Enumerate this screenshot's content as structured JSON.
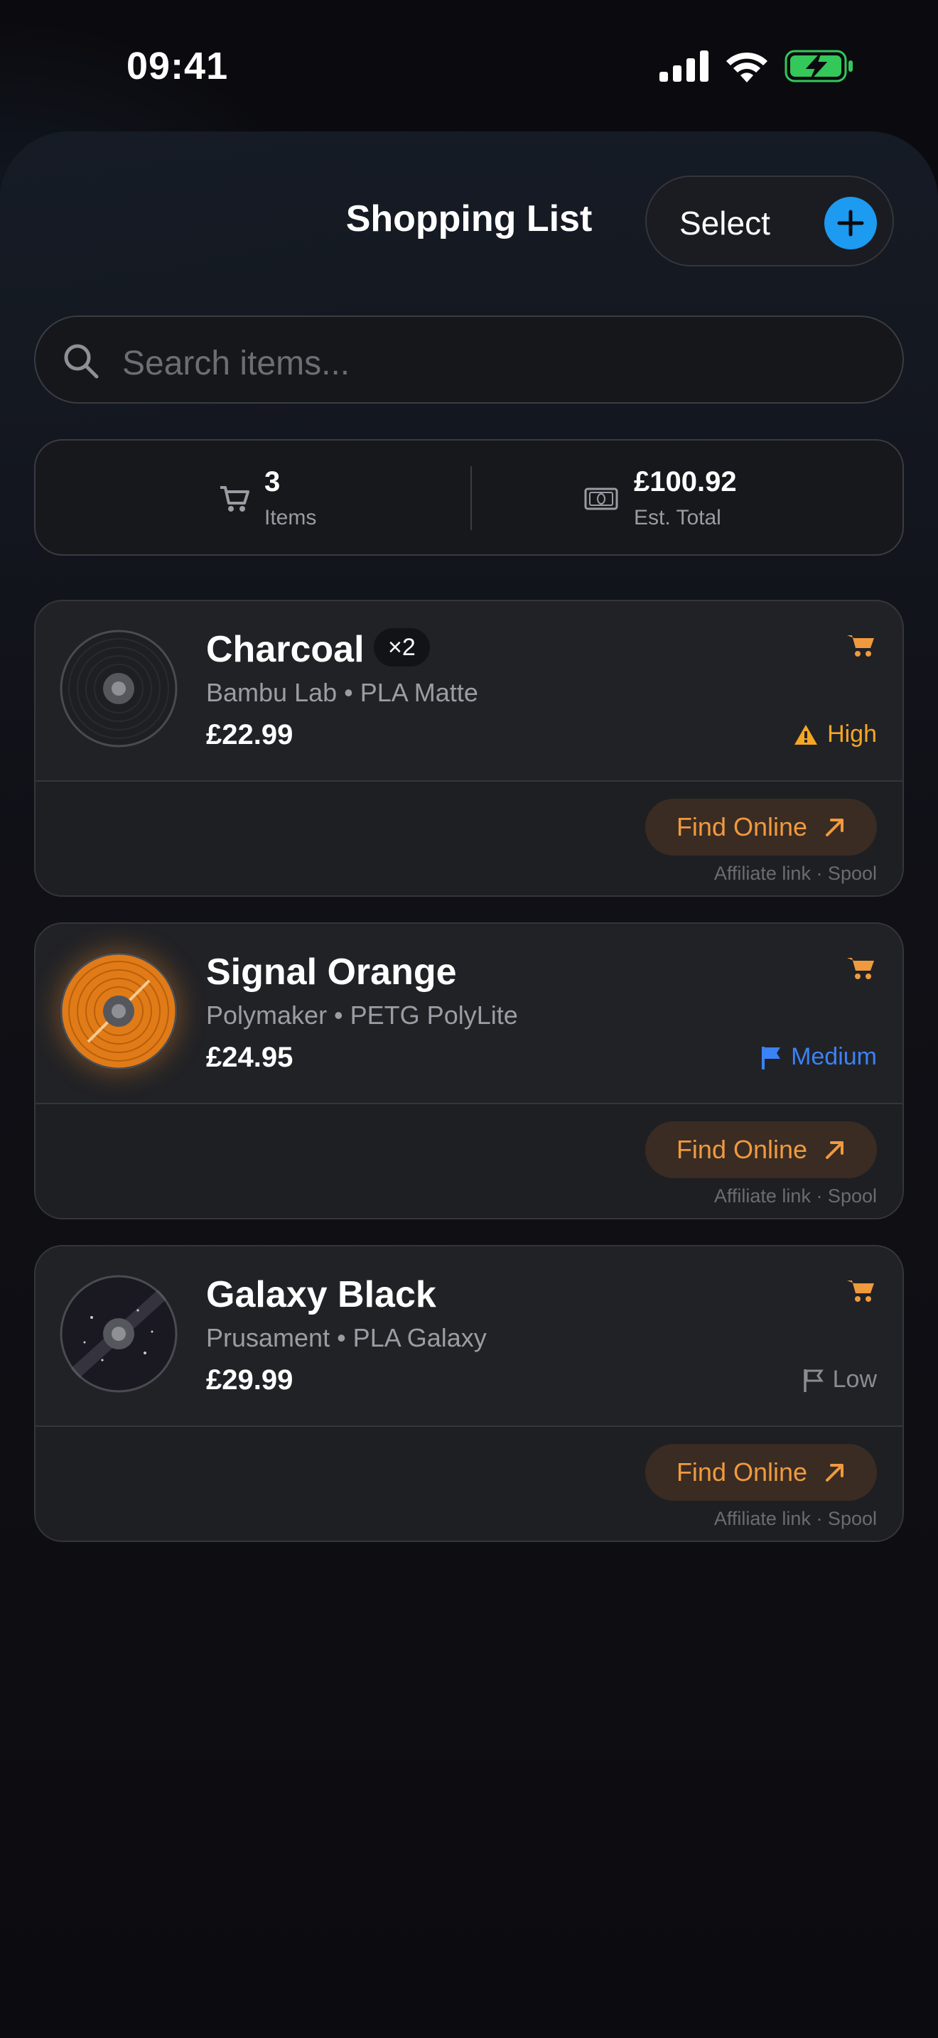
{
  "status_bar": {
    "time": "09:41"
  },
  "nav": {
    "title": "Shopping List",
    "select_label": "Select"
  },
  "search": {
    "placeholder": "Search items..."
  },
  "summary": {
    "items_count": "3",
    "items_label": "Items",
    "total_value": "£100.92",
    "total_label": "Est. Total"
  },
  "items": [
    {
      "name": "Charcoal",
      "quantity_badge": "×2",
      "subtitle": "Bambu Lab • PLA Matte",
      "price": "£22.99",
      "priority": "High",
      "priority_color": "#f5a623",
      "find_label": "Find Online",
      "affiliate_note": "Affiliate link · Spool"
    },
    {
      "name": "Signal Orange",
      "subtitle": "Polymaker • PETG PolyLite",
      "price": "£24.95",
      "priority": "Medium",
      "priority_color": "#3b82f6",
      "find_label": "Find Online",
      "affiliate_note": "Affiliate link · Spool"
    },
    {
      "name": "Galaxy Black",
      "subtitle": "Prusament • PLA Galaxy",
      "price": "£29.99",
      "priority": "Low",
      "priority_color": "#8a8c93",
      "find_label": "Find Online",
      "affiliate_note": "Affiliate link · Spool"
    }
  ],
  "colors": {
    "accent_orange": "#f09a3e",
    "accent_blue": "#1c9bf0",
    "battery_green": "#34c759"
  }
}
